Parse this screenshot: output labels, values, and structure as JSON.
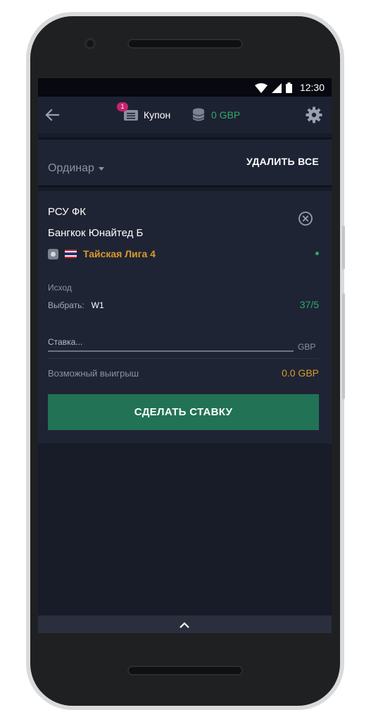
{
  "status_bar": {
    "time": "12:30",
    "icons": [
      "wifi-icon",
      "signal-icon",
      "battery-icon"
    ]
  },
  "header": {
    "back_icon": "arrow-left-icon",
    "coupon": {
      "label": "Купон",
      "badge": "1",
      "icon": "list-icon"
    },
    "balance": {
      "amount": "0 GBP",
      "icon": "coins-icon"
    },
    "settings_icon": "gear-icon"
  },
  "bet_type_bar": {
    "bet_type": "Ординар",
    "delete_all": "УДАЛИТЬ ВСЕ"
  },
  "bet": {
    "home_team": "РСУ ФК",
    "away_team": "Бангкок Юнайтед Б",
    "league": "Тайская Лига 4",
    "outcome_label": "Исход",
    "pick_label": "Выбрать:",
    "pick_value": "W1",
    "odds": "37/5",
    "stake_placeholder": "Ставка...",
    "stake_currency": "GBP",
    "payout_label": "Возможный выигрыш",
    "payout_value": "0.0 GBP",
    "place_bet": "СДЕЛАТЬ СТАВКУ"
  },
  "colors": {
    "background": "#181b28",
    "panel": "#1f2434",
    "accent_green": "#2fa86a",
    "button_green": "#227255",
    "accent_gold": "#d99a27",
    "badge": "#c8226d"
  }
}
